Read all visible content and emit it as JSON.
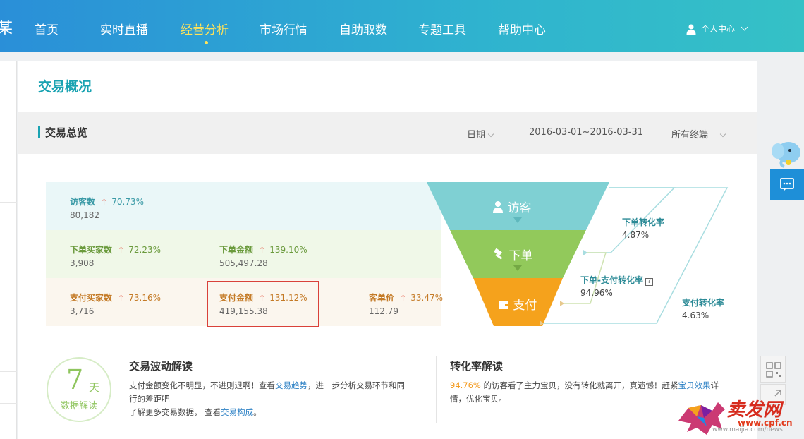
{
  "nav": {
    "logo_fragment": "某",
    "items": [
      {
        "label": "首页"
      },
      {
        "label": "实时直播"
      },
      {
        "label": "经营分析"
      },
      {
        "label": "市场行情"
      },
      {
        "label": "自助取数"
      },
      {
        "label": "专题工具"
      },
      {
        "label": "帮助中心"
      }
    ],
    "active_index": 2,
    "user_label": "个人中心"
  },
  "page": {
    "section_title": "交易概况",
    "sub_title": "交易总览",
    "filters": {
      "date_label": "日期",
      "date_range": "2016-03-01~2016-03-31",
      "terminal": "所有终端"
    }
  },
  "metrics": {
    "visitors": {
      "label": "访客数",
      "pct": "70.73%",
      "value": "80,182"
    },
    "order_buyers": {
      "label": "下单买家数",
      "pct": "72.23%",
      "value": "3,908"
    },
    "order_amount": {
      "label": "下单金额",
      "pct": "139.10%",
      "value": "505,497.28"
    },
    "pay_buyers": {
      "label": "支付买家数",
      "pct": "73.16%",
      "value": "3,716"
    },
    "pay_amount": {
      "label": "支付金额",
      "pct": "131.12%",
      "value": "419,155.38"
    },
    "avg_price": {
      "label": "客单价",
      "pct": "33.47%",
      "value": "112.79"
    }
  },
  "funnel": {
    "stages": [
      {
        "label": "访客",
        "color": "#7fd0d3"
      },
      {
        "label": "下单",
        "color": "#92c95b"
      },
      {
        "label": "支付",
        "color": "#f5a21c"
      }
    ],
    "rates": {
      "order_conv": {
        "title": "下单转化率",
        "value": "4.87%"
      },
      "order_pay_conv": {
        "title": "下单-支付转化率",
        "value": "94.96%",
        "help": "?"
      },
      "pay_conv": {
        "title": "支付转化率",
        "value": "4.63%"
      }
    }
  },
  "badge": {
    "num": "7",
    "unit": "天",
    "text": "数据解读"
  },
  "interp_trade": {
    "title": "交易波动解读",
    "line1_a": "支付金额变化不明显，不进则退啊！查看",
    "line1_link": "交易趋势",
    "line1_b": "，进一步分析交易环节和同",
    "line2": "行的差距吧",
    "line3_a": "了解更多交易数据，  查看",
    "line3_link": "交易构成",
    "line3_b": "。"
  },
  "interp_conv": {
    "title": "转化率解读",
    "pct": "94.76%",
    "line1_a": "的访客看了主力宝贝，没有转化就离开，真遗憾！赶紧",
    "line1_link": "宝贝效果",
    "line1_b": "详",
    "line2": "情，优化宝贝。"
  },
  "watermark": {
    "text": "卖发网",
    "url": "www.cpf.cn",
    "sub": "www.maijia.com/news"
  },
  "colors": {
    "accent": "#1aa3b2",
    "up": "#e2503c",
    "highlight": "#d9413a"
  }
}
